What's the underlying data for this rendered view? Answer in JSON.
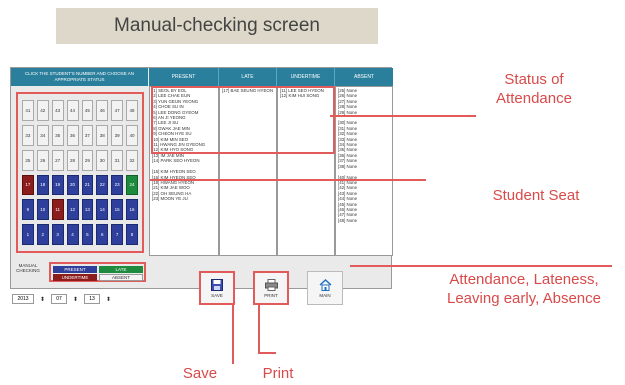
{
  "banner": {
    "title": "Manual-checking screen"
  },
  "seat_panel": {
    "header": "CLICK THE STUDENT'S NUMBER AND CHOOSE AN APPROPRIATE STATUS",
    "rows": [
      [
        {
          "n": "41",
          "s": "none"
        },
        {
          "n": "42",
          "s": "none"
        },
        {
          "n": "43",
          "s": "none"
        },
        {
          "n": "44",
          "s": "none"
        },
        {
          "n": "45",
          "s": "none"
        },
        {
          "n": "46",
          "s": "none"
        },
        {
          "n": "47",
          "s": "none"
        },
        {
          "n": "48",
          "s": "none"
        }
      ],
      [
        {
          "n": "33",
          "s": "none"
        },
        {
          "n": "34",
          "s": "none"
        },
        {
          "n": "35",
          "s": "none"
        },
        {
          "n": "36",
          "s": "none"
        },
        {
          "n": "37",
          "s": "none"
        },
        {
          "n": "38",
          "s": "none"
        },
        {
          "n": "39",
          "s": "none"
        },
        {
          "n": "40",
          "s": "none"
        }
      ],
      [
        {
          "n": "25",
          "s": "none"
        },
        {
          "n": "26",
          "s": "none"
        },
        {
          "n": "27",
          "s": "none"
        },
        {
          "n": "28",
          "s": "none"
        },
        {
          "n": "29",
          "s": "none"
        },
        {
          "n": "30",
          "s": "none"
        },
        {
          "n": "31",
          "s": "none"
        },
        {
          "n": "32",
          "s": "none"
        }
      ],
      [
        {
          "n": "17",
          "s": "red"
        },
        {
          "n": "18",
          "s": "blue"
        },
        {
          "n": "19",
          "s": "blue"
        },
        {
          "n": "20",
          "s": "blue"
        },
        {
          "n": "21",
          "s": "blue"
        },
        {
          "n": "22",
          "s": "blue"
        },
        {
          "n": "23",
          "s": "blue"
        },
        {
          "n": "24",
          "s": "green"
        }
      ],
      [
        {
          "n": "9",
          "s": "blue"
        },
        {
          "n": "10",
          "s": "blue"
        },
        {
          "n": "11",
          "s": "red"
        },
        {
          "n": "12",
          "s": "blue"
        },
        {
          "n": "13",
          "s": "blue"
        },
        {
          "n": "14",
          "s": "blue"
        },
        {
          "n": "15",
          "s": "blue"
        },
        {
          "n": "16",
          "s": "blue"
        }
      ],
      [
        {
          "n": "1",
          "s": "blue"
        },
        {
          "n": "2",
          "s": "blue"
        },
        {
          "n": "3",
          "s": "blue"
        },
        {
          "n": "4",
          "s": "blue"
        },
        {
          "n": "5",
          "s": "blue"
        },
        {
          "n": "6",
          "s": "blue"
        },
        {
          "n": "7",
          "s": "blue"
        },
        {
          "n": "8",
          "s": "blue"
        }
      ]
    ]
  },
  "status_table": {
    "headers": [
      "PRESENT",
      "LATE",
      "UNDERTIME",
      "ABSENT"
    ],
    "present": [
      "[1] SEOL BY EOL",
      "[2] LEE CHAE EUN",
      "[3] YUN GEUN YEONG",
      "[4] CHOE SU IN",
      "[5] LEE DONG GYEOM",
      "[6] AN JI YEONG",
      "[7] LEE JI SU",
      "[8] GWAK JAE MIN",
      "[9] CHEON HYE SU",
      "[10] KIM MIN SEO",
      "[11] HWANG JIN GYEONG",
      "[12] KIM HYO SONG",
      "[13] IM JAE MIN",
      "[14] PARK SEO HYEON",
      "",
      "[15] KIM HYEON SEO",
      "[16] KIM HYEON SEO",
      "[18] HWANG HYEON",
      "[21] KIM JAE WOO",
      "[22] OH SEUNG HA",
      "[23] MOON YE JU"
    ],
    "late": [
      "[17] BAE SEUNG HYEON"
    ],
    "undertime": [
      "[11] LEE SEO HYEON",
      "[12] KIM HUI SONG"
    ],
    "absent": [
      "[25] None",
      "[26] None",
      "[27] None",
      "[28] None",
      "[29] None",
      "",
      "[30] None",
      "[31] None",
      "[32] None",
      "[33] None",
      "[34] None",
      "[35] None",
      "[36] None",
      "[37] None",
      "[38] None",
      "",
      "[40] None",
      "[41] None",
      "[42] None",
      "[43] None",
      "[44] None",
      "[45] None",
      "[46] None",
      "[47] None",
      "[48] None"
    ]
  },
  "legend": {
    "label": "MANUAL CHECKING",
    "present": "PRESENT",
    "late": "LATE",
    "undertime": "UNDERTIME",
    "absent": "ABSENT"
  },
  "date": {
    "year": "2013",
    "month": "07",
    "day": "13"
  },
  "buttons": {
    "save": "SAVE",
    "print": "PRINT",
    "main": "MAIN"
  },
  "annotations": {
    "status": "Status of\nAttendance",
    "seat": "Student Seat",
    "legend": "Attendance, Lateness,\nLeaving early, Absence",
    "save": "Save",
    "print": "Print"
  },
  "colors": {
    "accent_red": "#e35a5a",
    "header_teal": "#2a7f9c",
    "seat_blue": "#2e3f9c",
    "seat_red": "#8c1d1d",
    "seat_green": "#1e8a3d"
  }
}
